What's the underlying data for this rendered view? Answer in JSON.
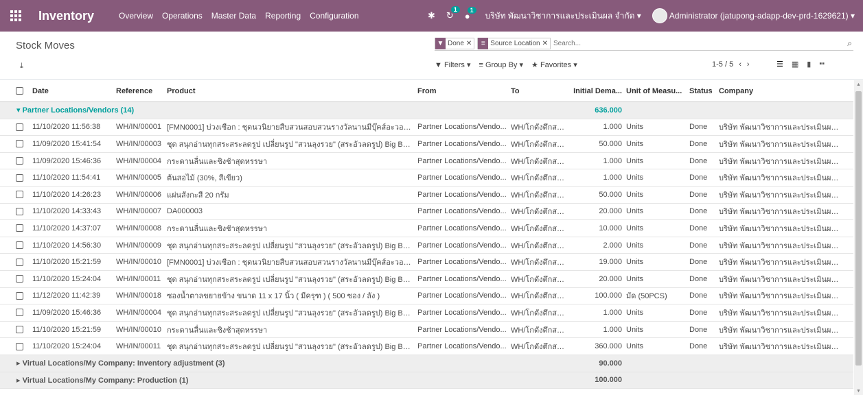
{
  "navbar": {
    "app_name": "Inventory",
    "menu": [
      "Overview",
      "Operations",
      "Master Data",
      "Reporting",
      "Configuration"
    ],
    "activity_badge": "1",
    "messages_badge": "1",
    "company": "บริษัท พัฒนาวิชาการและประเมินผล จำกัด",
    "user": "Administrator (jatupong-adapp-dev-prd-1629621)"
  },
  "control_panel": {
    "breadcrumb": "Stock Moves",
    "facets": [
      {
        "icon": "filter-icon",
        "label": "Done"
      },
      {
        "icon": "group-icon",
        "label": "Source Location"
      }
    ],
    "search_placeholder": "Search...",
    "filters_label": "Filters",
    "groupby_label": "Group By",
    "favorites_label": "Favorites",
    "pager": "1-5 / 5"
  },
  "table": {
    "columns": [
      "Date",
      "Reference",
      "Product",
      "From",
      "To",
      "Initial Dema...",
      "Unit of Measu...",
      "Status",
      "Company"
    ],
    "group_open": {
      "label": "Partner Locations/Vendors (14)",
      "total": "636.000"
    },
    "rows": [
      {
        "date": "11/10/2020 11:56:38",
        "ref": "WH/IN/00001",
        "product": "[FMN0001] บ่วงเชือก : ชุดนวนิยายสืบสวนสอบสวนรางวัลนานมีบุ๊คส์อะวอร์ด ครั้ง...",
        "from": "Partner Locations/Vendo...",
        "to": "WH/โกดังตึกสม า",
        "qty": "1.000",
        "uom": "Units",
        "status": "Done",
        "company": "บริษัท พัฒนาวิชาการและประเมินผล จำ..."
      },
      {
        "date": "11/09/2020 15:41:54",
        "ref": "WH/IN/00003",
        "product": "ชุด สนุกอ่านทุกสระสระลดรูป เปลี่ยนรูป \"สวนลุงรวย\" (สระอัวลดรูป) Big Book",
        "from": "Partner Locations/Vendo...",
        "to": "WH/โกดังตึกสม า",
        "qty": "50.000",
        "uom": "Units",
        "status": "Done",
        "company": "บริษัท พัฒนาวิชาการและประเมินผล จำ..."
      },
      {
        "date": "11/09/2020 15:46:36",
        "ref": "WH/IN/00004",
        "product": "กระดานลื่นและชิงช้าสุดหรรษา",
        "from": "Partner Locations/Vendo...",
        "to": "WH/โกดังตึกสม า",
        "qty": "1.000",
        "uom": "Units",
        "status": "Done",
        "company": "บริษัท พัฒนาวิชาการและประเมินผล จำ..."
      },
      {
        "date": "11/10/2020 11:54:41",
        "ref": "WH/IN/00005",
        "product": "ต้นสอไม้ (30%, สีเขียว)",
        "from": "Partner Locations/Vendo...",
        "to": "WH/โกดังตึกสม า",
        "qty": "1.000",
        "uom": "Units",
        "status": "Done",
        "company": "บริษัท พัฒนาวิชาการและประเมินผล จำ..."
      },
      {
        "date": "11/10/2020 14:26:23",
        "ref": "WH/IN/00006",
        "product": "แผ่นสังกะสี 20 กรัม",
        "from": "Partner Locations/Vendo...",
        "to": "WH/โกดังตึกสม า",
        "qty": "50.000",
        "uom": "Units",
        "status": "Done",
        "company": "บริษัท พัฒนาวิชาการและประเมินผล จำ..."
      },
      {
        "date": "11/10/2020 14:33:43",
        "ref": "WH/IN/00007",
        "product": "DA000003",
        "from": "Partner Locations/Vendo...",
        "to": "WH/โกดังตึกสม า",
        "qty": "20.000",
        "uom": "Units",
        "status": "Done",
        "company": "บริษัท พัฒนาวิชาการและประเมินผล จำ..."
      },
      {
        "date": "11/10/2020 14:37:07",
        "ref": "WH/IN/00008",
        "product": "กระดานลื่นและชิงช้าสุดหรรษา",
        "from": "Partner Locations/Vendo...",
        "to": "WH/โกดังตึกสม า",
        "qty": "10.000",
        "uom": "Units",
        "status": "Done",
        "company": "บริษัท พัฒนาวิชาการและประเมินผล จำ..."
      },
      {
        "date": "11/10/2020 14:56:30",
        "ref": "WH/IN/00009",
        "product": "ชุด สนุกอ่านทุกสระสระลดรูป เปลี่ยนรูป \"สวนลุงรวย\" (สระอัวลดรูป) Big Book",
        "from": "Partner Locations/Vendo...",
        "to": "WH/โกดังตึกสม า",
        "qty": "2.000",
        "uom": "Units",
        "status": "Done",
        "company": "บริษัท พัฒนาวิชาการและประเมินผล จำ..."
      },
      {
        "date": "11/10/2020 15:21:59",
        "ref": "WH/IN/00010",
        "product": "[FMN0001] บ่วงเชือก : ชุดนวนิยายสืบสวนสอบสวนรางวัลนานมีบุ๊คส์อะวอร์ด ครั้ง...",
        "from": "Partner Locations/Vendo...",
        "to": "WH/โกดังตึกสม า",
        "qty": "19.000",
        "uom": "Units",
        "status": "Done",
        "company": "บริษัท พัฒนาวิชาการและประเมินผล จำ..."
      },
      {
        "date": "11/10/2020 15:24:04",
        "ref": "WH/IN/00011",
        "product": "ชุด สนุกอ่านทุกสระสระลดรูป เปลี่ยนรูป \"สวนลุงรวย\" (สระอัวลดรูป) Big Book สำห...",
        "from": "Partner Locations/Vendo...",
        "to": "WH/โกดังตึกสม า",
        "qty": "20.000",
        "uom": "Units",
        "status": "Done",
        "company": "บริษัท พัฒนาวิชาการและประเมินผล จำ..."
      },
      {
        "date": "11/12/2020 11:42:39",
        "ref": "WH/IN/00018",
        "product": "ซองน้ำตาลขยายข้าง ขนาด 11 x 17 นิ้ว ( มีครุฑ ) ( 500 ซอง / ลัง )",
        "from": "Partner Locations/Vendo...",
        "to": "WH/โกดังตึกสม า",
        "qty": "100.000",
        "uom": "มัด (50PCS)",
        "status": "Done",
        "company": "บริษัท พัฒนาวิชาการและประเมินผล จำ..."
      },
      {
        "date": "11/09/2020 15:46:36",
        "ref": "WH/IN/00004",
        "product": "ชุด สนุกอ่านทุกสระสระลดรูป เปลี่ยนรูป \"สวนลุงรวย\" (สระอัวลดรูป) Big Book",
        "from": "Partner Locations/Vendo...",
        "to": "WH/โกดังตึกสม า",
        "qty": "1.000",
        "uom": "Units",
        "status": "Done",
        "company": "บริษัท พัฒนาวิชาการและประเมินผล จำ..."
      },
      {
        "date": "11/10/2020 15:21:59",
        "ref": "WH/IN/00010",
        "product": "กระดานลื่นและชิงช้าสุดหรรษา",
        "from": "Partner Locations/Vendo...",
        "to": "WH/โกดังตึกสม า",
        "qty": "1.000",
        "uom": "Units",
        "status": "Done",
        "company": "บริษัท พัฒนาวิชาการและประเมินผล จำ..."
      },
      {
        "date": "11/10/2020 15:24:04",
        "ref": "WH/IN/00011",
        "product": "ชุด สนุกอ่านทุกสระสระลดรูป เปลี่ยนรูป \"สวนลุงรวย\" (สระอัวลดรูป) Big Book สำห...",
        "from": "Partner Locations/Vendo...",
        "to": "WH/โกดังตึกสม า",
        "qty": "360.000",
        "uom": "Units",
        "status": "Done",
        "company": "บริษัท พัฒนาวิชาการและประเมินผล จำ..."
      }
    ],
    "groups_closed": [
      {
        "label": "Virtual Locations/My Company: Inventory adjustment (3)",
        "total": "90.000"
      },
      {
        "label": "Virtual Locations/My Company: Production (1)",
        "total": "100.000"
      }
    ]
  },
  "colors": {
    "brand": "#875a7b",
    "accent": "#00a09d"
  }
}
